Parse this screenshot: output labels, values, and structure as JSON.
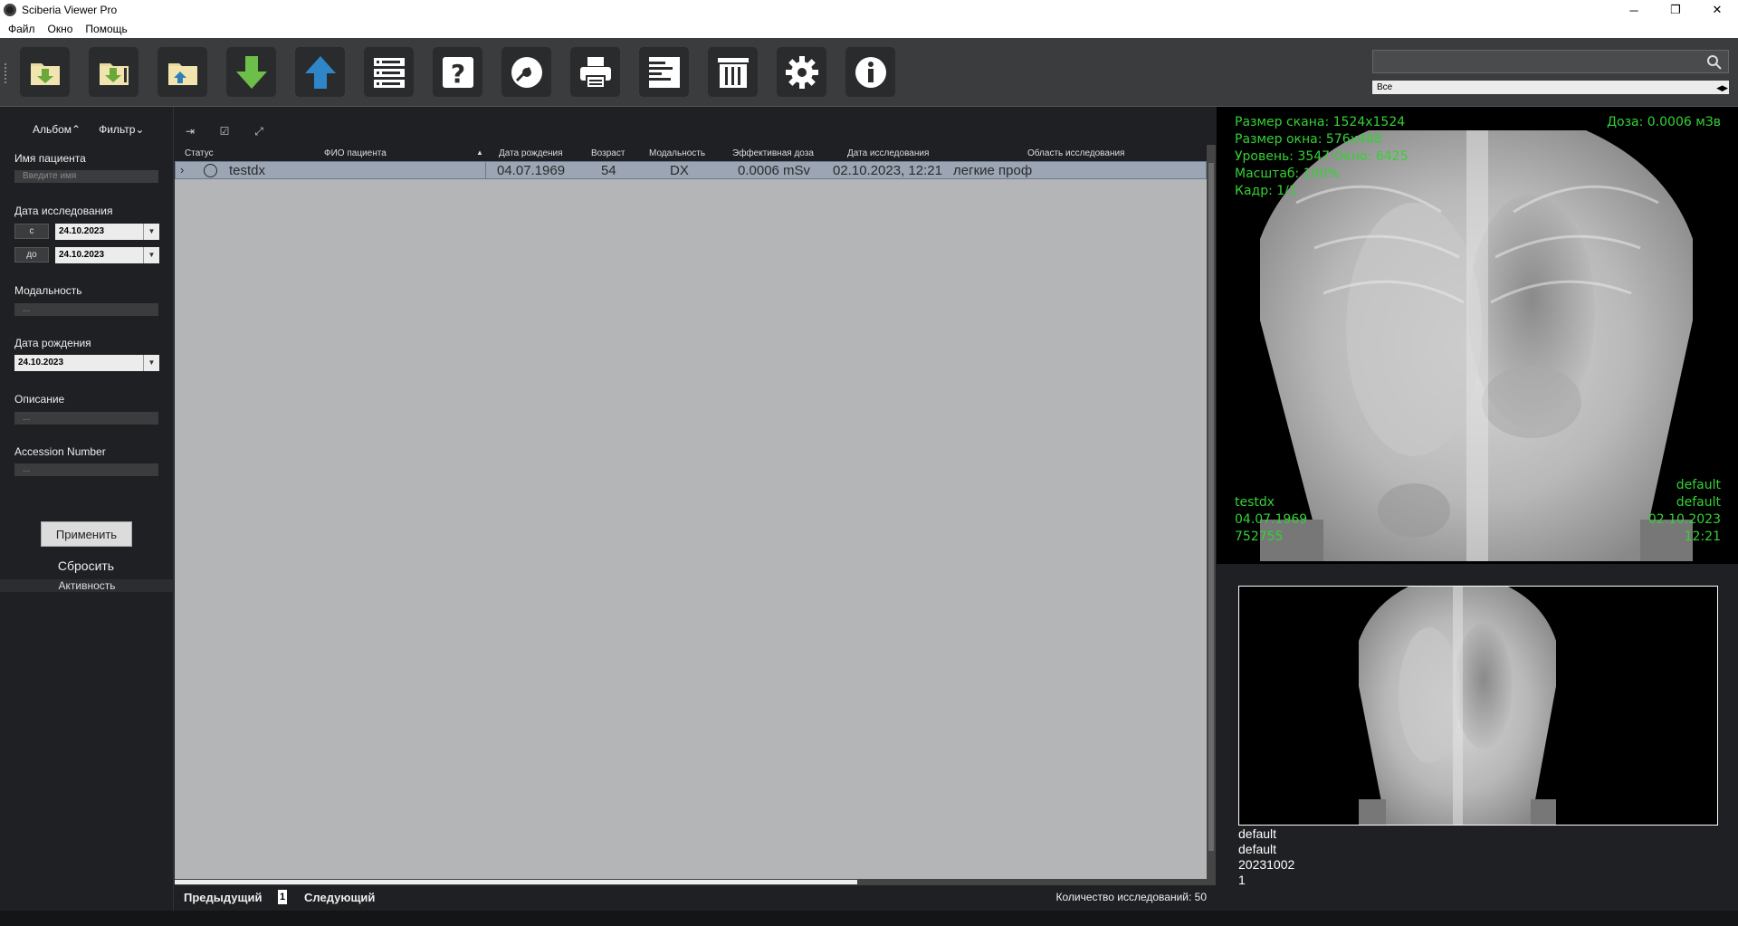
{
  "window": {
    "title": "Sciberia Viewer Pro",
    "minimize": "─",
    "maximize": "❐",
    "close": "✕"
  },
  "menu": [
    "Файл",
    "Окно",
    "Помощь"
  ],
  "toolbar": {
    "buttons": [
      "open-folder",
      "import",
      "open-local",
      "download",
      "upload",
      "storage",
      "help",
      "burn-disc",
      "print",
      "report",
      "delete",
      "settings",
      "info"
    ],
    "search_placeholder": "",
    "filter_select": "Все"
  },
  "left": {
    "tabs": [
      "Альбом⌃",
      "Фильтр⌄"
    ],
    "patient_name_label": "Имя пациента",
    "patient_name_placeholder": "Введите имя",
    "study_date_label": "Дата исследования",
    "from_label": "с",
    "to_label": "до",
    "from_date": "24.10.2023",
    "to_date": "24.10.2023",
    "modality_label": "Модальность",
    "modality_value": "...",
    "birth_date_label": "Дата рождения",
    "birth_date": "24.10.2023",
    "description_label": "Описание",
    "description_value": "...",
    "accession_label": "Accession Number",
    "accession_value": "...",
    "apply": "Применить",
    "reset": "Сбросить",
    "activity": "Активность"
  },
  "table": {
    "columns": [
      "Статус",
      "ФИО пациента",
      "Дата рождения",
      "Возраст",
      "Модальность",
      "Эффективная доза",
      "Дата исследования",
      "Область исследования"
    ],
    "rows": [
      {
        "name": "testdx",
        "birth": "04.07.1969",
        "age": "54",
        "modality": "DX",
        "dose": "0.0006 mSv",
        "study_date": "02.10.2023, 12:21",
        "region": "легкие проф"
      }
    ]
  },
  "pager": {
    "prev": "Предыдущий",
    "page": "1",
    "next": "Следующий",
    "count": "Количество исследований: 50"
  },
  "viewer": {
    "tl": [
      "Размер скана: 1524x1524",
      "Размер окна: 576x488",
      "Уровень: 3547 Окно: 6425",
      "Масштаб: 100%",
      "Кадр: 1/1"
    ],
    "tr": "Доза: 0.0006 мЗв",
    "bl": [
      "testdx",
      "04.07.1969",
      "752755"
    ],
    "br": [
      "default",
      "default",
      "02.10.2023",
      "12:21"
    ],
    "overlay_color": "#35d135"
  },
  "thumbnail": {
    "info": [
      "default",
      "default",
      "20231002",
      "1"
    ]
  }
}
